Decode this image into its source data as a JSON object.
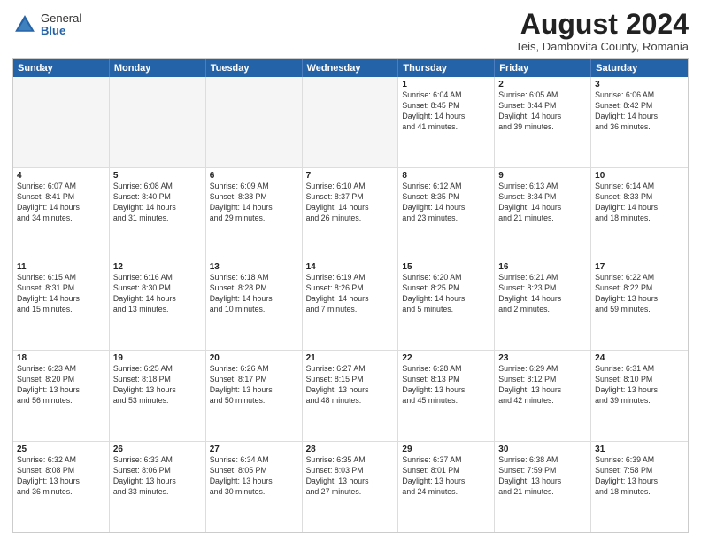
{
  "header": {
    "logo_general": "General",
    "logo_blue": "Blue",
    "month_title": "August 2024",
    "location": "Teis, Dambovita County, Romania"
  },
  "calendar": {
    "days_of_week": [
      "Sunday",
      "Monday",
      "Tuesday",
      "Wednesday",
      "Thursday",
      "Friday",
      "Saturday"
    ],
    "rows": [
      [
        {
          "day": "",
          "info": "",
          "empty": true
        },
        {
          "day": "",
          "info": "",
          "empty": true
        },
        {
          "day": "",
          "info": "",
          "empty": true
        },
        {
          "day": "",
          "info": "",
          "empty": true
        },
        {
          "day": "1",
          "info": "Sunrise: 6:04 AM\nSunset: 8:45 PM\nDaylight: 14 hours\nand 41 minutes.",
          "empty": false
        },
        {
          "day": "2",
          "info": "Sunrise: 6:05 AM\nSunset: 8:44 PM\nDaylight: 14 hours\nand 39 minutes.",
          "empty": false
        },
        {
          "day": "3",
          "info": "Sunrise: 6:06 AM\nSunset: 8:42 PM\nDaylight: 14 hours\nand 36 minutes.",
          "empty": false
        }
      ],
      [
        {
          "day": "4",
          "info": "Sunrise: 6:07 AM\nSunset: 8:41 PM\nDaylight: 14 hours\nand 34 minutes.",
          "empty": false
        },
        {
          "day": "5",
          "info": "Sunrise: 6:08 AM\nSunset: 8:40 PM\nDaylight: 14 hours\nand 31 minutes.",
          "empty": false
        },
        {
          "day": "6",
          "info": "Sunrise: 6:09 AM\nSunset: 8:38 PM\nDaylight: 14 hours\nand 29 minutes.",
          "empty": false
        },
        {
          "day": "7",
          "info": "Sunrise: 6:10 AM\nSunset: 8:37 PM\nDaylight: 14 hours\nand 26 minutes.",
          "empty": false
        },
        {
          "day": "8",
          "info": "Sunrise: 6:12 AM\nSunset: 8:35 PM\nDaylight: 14 hours\nand 23 minutes.",
          "empty": false
        },
        {
          "day": "9",
          "info": "Sunrise: 6:13 AM\nSunset: 8:34 PM\nDaylight: 14 hours\nand 21 minutes.",
          "empty": false
        },
        {
          "day": "10",
          "info": "Sunrise: 6:14 AM\nSunset: 8:33 PM\nDaylight: 14 hours\nand 18 minutes.",
          "empty": false
        }
      ],
      [
        {
          "day": "11",
          "info": "Sunrise: 6:15 AM\nSunset: 8:31 PM\nDaylight: 14 hours\nand 15 minutes.",
          "empty": false
        },
        {
          "day": "12",
          "info": "Sunrise: 6:16 AM\nSunset: 8:30 PM\nDaylight: 14 hours\nand 13 minutes.",
          "empty": false
        },
        {
          "day": "13",
          "info": "Sunrise: 6:18 AM\nSunset: 8:28 PM\nDaylight: 14 hours\nand 10 minutes.",
          "empty": false
        },
        {
          "day": "14",
          "info": "Sunrise: 6:19 AM\nSunset: 8:26 PM\nDaylight: 14 hours\nand 7 minutes.",
          "empty": false
        },
        {
          "day": "15",
          "info": "Sunrise: 6:20 AM\nSunset: 8:25 PM\nDaylight: 14 hours\nand 5 minutes.",
          "empty": false
        },
        {
          "day": "16",
          "info": "Sunrise: 6:21 AM\nSunset: 8:23 PM\nDaylight: 14 hours\nand 2 minutes.",
          "empty": false
        },
        {
          "day": "17",
          "info": "Sunrise: 6:22 AM\nSunset: 8:22 PM\nDaylight: 13 hours\nand 59 minutes.",
          "empty": false
        }
      ],
      [
        {
          "day": "18",
          "info": "Sunrise: 6:23 AM\nSunset: 8:20 PM\nDaylight: 13 hours\nand 56 minutes.",
          "empty": false
        },
        {
          "day": "19",
          "info": "Sunrise: 6:25 AM\nSunset: 8:18 PM\nDaylight: 13 hours\nand 53 minutes.",
          "empty": false
        },
        {
          "day": "20",
          "info": "Sunrise: 6:26 AM\nSunset: 8:17 PM\nDaylight: 13 hours\nand 50 minutes.",
          "empty": false
        },
        {
          "day": "21",
          "info": "Sunrise: 6:27 AM\nSunset: 8:15 PM\nDaylight: 13 hours\nand 48 minutes.",
          "empty": false
        },
        {
          "day": "22",
          "info": "Sunrise: 6:28 AM\nSunset: 8:13 PM\nDaylight: 13 hours\nand 45 minutes.",
          "empty": false
        },
        {
          "day": "23",
          "info": "Sunrise: 6:29 AM\nSunset: 8:12 PM\nDaylight: 13 hours\nand 42 minutes.",
          "empty": false
        },
        {
          "day": "24",
          "info": "Sunrise: 6:31 AM\nSunset: 8:10 PM\nDaylight: 13 hours\nand 39 minutes.",
          "empty": false
        }
      ],
      [
        {
          "day": "25",
          "info": "Sunrise: 6:32 AM\nSunset: 8:08 PM\nDaylight: 13 hours\nand 36 minutes.",
          "empty": false
        },
        {
          "day": "26",
          "info": "Sunrise: 6:33 AM\nSunset: 8:06 PM\nDaylight: 13 hours\nand 33 minutes.",
          "empty": false
        },
        {
          "day": "27",
          "info": "Sunrise: 6:34 AM\nSunset: 8:05 PM\nDaylight: 13 hours\nand 30 minutes.",
          "empty": false
        },
        {
          "day": "28",
          "info": "Sunrise: 6:35 AM\nSunset: 8:03 PM\nDaylight: 13 hours\nand 27 minutes.",
          "empty": false
        },
        {
          "day": "29",
          "info": "Sunrise: 6:37 AM\nSunset: 8:01 PM\nDaylight: 13 hours\nand 24 minutes.",
          "empty": false
        },
        {
          "day": "30",
          "info": "Sunrise: 6:38 AM\nSunset: 7:59 PM\nDaylight: 13 hours\nand 21 minutes.",
          "empty": false
        },
        {
          "day": "31",
          "info": "Sunrise: 6:39 AM\nSunset: 7:58 PM\nDaylight: 13 hours\nand 18 minutes.",
          "empty": false
        }
      ]
    ]
  }
}
